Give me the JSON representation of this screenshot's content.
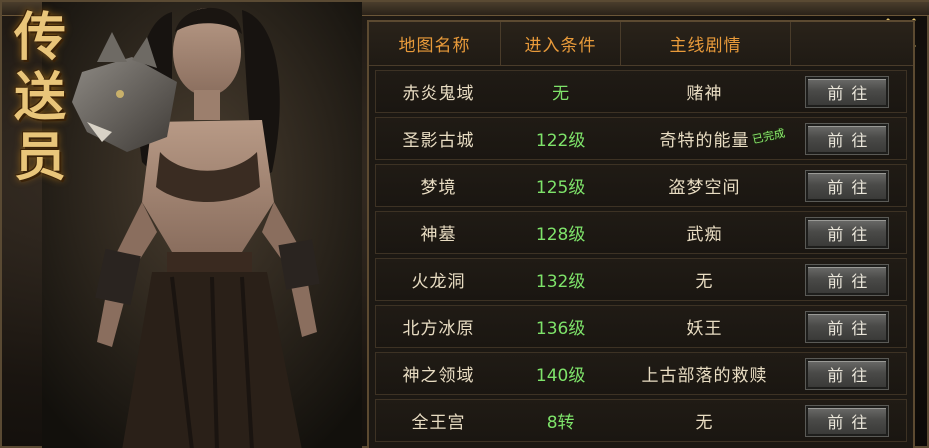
{
  "title_chars": [
    "传",
    "送",
    "员"
  ],
  "headers": {
    "map_name": "地图名称",
    "requirement": "进入条件",
    "main_quest": "主线剧情"
  },
  "go_label": "前往",
  "completed_label": "已完成",
  "rows": [
    {
      "map": "赤炎鬼域",
      "req": "无",
      "quest": "赌神",
      "completed": false
    },
    {
      "map": "圣影古城",
      "req": "122级",
      "quest": "奇特的能量",
      "completed": true
    },
    {
      "map": "梦境",
      "req": "125级",
      "quest": "盗梦空间",
      "completed": false
    },
    {
      "map": "神墓",
      "req": "128级",
      "quest": "武痴",
      "completed": false
    },
    {
      "map": "火龙洞",
      "req": "132级",
      "quest": "无",
      "completed": false
    },
    {
      "map": "北方冰原",
      "req": "136级",
      "quest": "妖王",
      "completed": false
    },
    {
      "map": "神之领域",
      "req": "140级",
      "quest": "上古部落的救赎",
      "completed": false
    },
    {
      "map": "全王宫",
      "req": "8转",
      "quest": "无",
      "completed": false
    }
  ],
  "colors": {
    "header_text": "#e89a3a",
    "requirement_text": "#7ee36a",
    "title_gold": "#e9c57a",
    "completed_badge": "#8be86c"
  },
  "icons": {
    "close": "crossed-swords-close-icon"
  }
}
